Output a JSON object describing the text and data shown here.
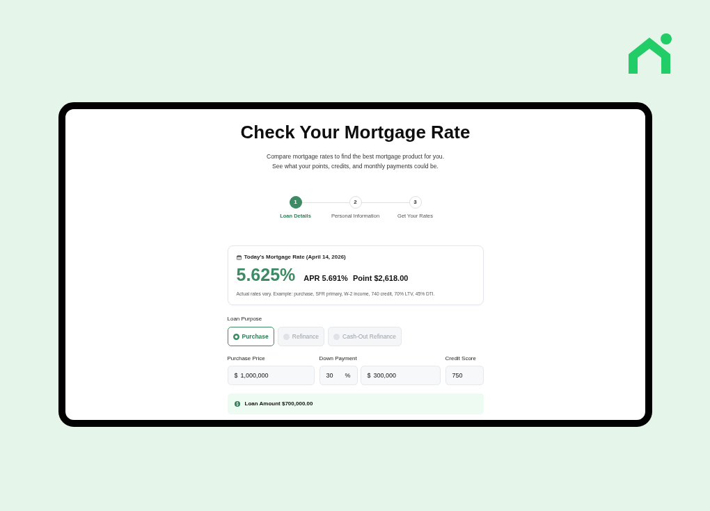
{
  "header": {
    "title": "Check Your Mortgage Rate",
    "subtitle_lines": [
      "Compare mortgage rates to find the best mortgage product for you.",
      "See what your points, credits, and monthly payments could be."
    ]
  },
  "steps": [
    {
      "number": "1",
      "label": "Loan Details",
      "selected": true
    },
    {
      "number": "2",
      "label": "Personal Information",
      "selected": false
    },
    {
      "number": "3",
      "label": "Get Your Rates",
      "selected": false
    }
  ],
  "rate_card": {
    "heading": "Today's Mortgage Rate (April 14, 2026)",
    "rate": "5.625%",
    "apr": "APR 5.691%",
    "point": "Point $2,618.00",
    "disclaimer": "Actual rates vary. Example: purchase, SFR primary, W-2 income, 740 credit, 70% LTV, 45% DTI."
  },
  "loan_purpose": {
    "label": "Loan Purpose",
    "options": [
      {
        "label": "Purchase",
        "selected": true
      },
      {
        "label": "Refinance",
        "selected": false
      },
      {
        "label": "Cash-Out Refinance",
        "selected": false
      }
    ]
  },
  "fields": [
    {
      "label": "Purchase Price",
      "inputs": [
        {
          "prefix": "$",
          "value": "1,000,000"
        }
      ]
    },
    {
      "label": "Down Payment",
      "inputs": [
        {
          "value": "30",
          "suffix": "%"
        },
        {
          "prefix": "$",
          "value": "300,000"
        }
      ]
    },
    {
      "label": "Credit Score",
      "inputs": [
        {
          "value": "750"
        }
      ]
    }
  ],
  "loan_amount": {
    "text": "Loan Amount $700,000.00"
  }
}
